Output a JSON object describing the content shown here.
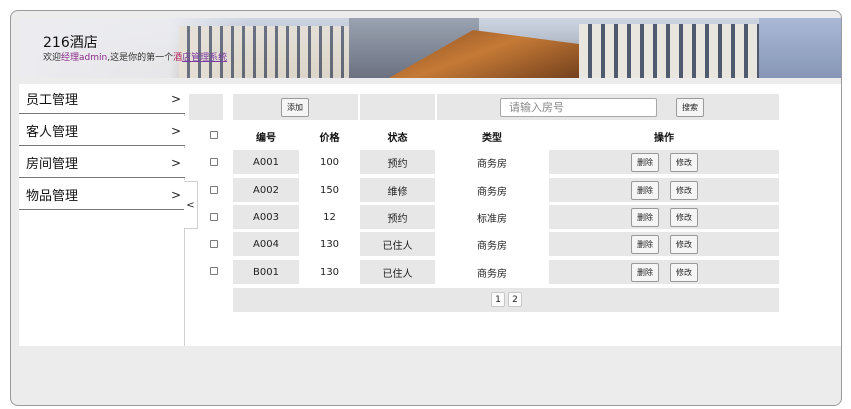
{
  "header": {
    "brand": "216酒店",
    "welcome_prefix": "欢迎",
    "role": "经理",
    "user": "admin",
    "welcome_mid": ",这是你的第一个",
    "link_prefix": "酒",
    "link_text": "店管理系统"
  },
  "sidebar": {
    "items": [
      {
        "label": "员工管理",
        "arrow": ">"
      },
      {
        "label": "客人管理",
        "arrow": ">"
      },
      {
        "label": "房间管理",
        "arrow": ">"
      },
      {
        "label": "物品管理",
        "arrow": ">"
      }
    ],
    "collapse": "<"
  },
  "toolbar": {
    "add_label": "添加",
    "search_placeholder": "请输入房号",
    "search_value": "",
    "search_label": "搜索"
  },
  "table": {
    "headers": {
      "number": "编号",
      "price": "价格",
      "status": "状态",
      "type": "类型",
      "actions": "操作"
    },
    "delete_label": "删除",
    "edit_label": "修改",
    "rows": [
      {
        "number": "A001",
        "price": "100",
        "status": "预约",
        "type": "商务房"
      },
      {
        "number": "A002",
        "price": "150",
        "status": "维修",
        "type": "商务房"
      },
      {
        "number": "A003",
        "price": "12",
        "status": "预约",
        "type": "标准房"
      },
      {
        "number": "A004",
        "price": "130",
        "status": "已住人",
        "type": "商务房"
      },
      {
        "number": "B001",
        "price": "130",
        "status": "已住人",
        "type": "商务房"
      }
    ]
  },
  "pagination": {
    "pages": [
      "1",
      "2"
    ]
  }
}
